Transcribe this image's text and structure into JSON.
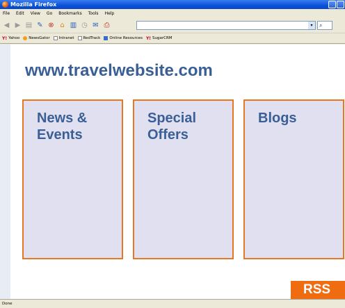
{
  "window": {
    "title": "Mozilla Firefox"
  },
  "menu": [
    "File",
    "Edit",
    "View",
    "Go",
    "Bookmarks",
    "Tools",
    "Help"
  ],
  "url": {
    "value": ""
  },
  "bookmarks": [
    {
      "label": "Yahoo",
      "icon": "yahoo-icon"
    },
    {
      "label": "NewsGator",
      "icon": "newsgator-icon"
    },
    {
      "label": "Intranet",
      "icon": "page-icon"
    },
    {
      "label": "RedTrack",
      "icon": "page-icon"
    },
    {
      "label": "Online Resources",
      "icon": "folder-icon"
    },
    {
      "label": "SugarCRM",
      "icon": "yahoo-icon"
    }
  ],
  "site": {
    "title": "www.travelwebsite.com",
    "cards": [
      {
        "label": "News &\nEvents"
      },
      {
        "label": "Special\nOffers"
      },
      {
        "label": "Blogs"
      }
    ],
    "rss_label": "RSS"
  },
  "status": {
    "text": "Done"
  },
  "colors": {
    "accent": "#e87722",
    "title": "#3a5f96",
    "card_bg": "#e0e0f0",
    "rss": "#ef6c10"
  }
}
